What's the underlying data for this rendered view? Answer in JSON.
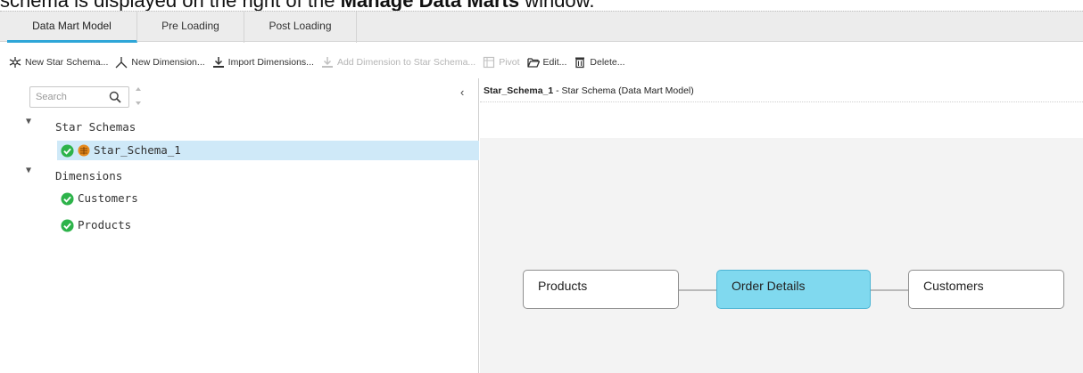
{
  "caption": {
    "prefix": "schema is displayed on the right of the ",
    "bold": "Manage Data Marts",
    "suffix": " window."
  },
  "tabs": [
    {
      "label": "Data Mart Model",
      "active": true
    },
    {
      "label": "Pre Loading",
      "active": false
    },
    {
      "label": "Post Loading",
      "active": false
    }
  ],
  "toolbar": {
    "new_star_schema": "New Star Schema...",
    "new_dimension": "New Dimension...",
    "import_dimensions": "Import Dimensions...",
    "add_dimension": "Add Dimension to Star Schema...",
    "pivot": "Pivot",
    "edit": "Edit...",
    "delete": "Delete..."
  },
  "search": {
    "placeholder": "Search"
  },
  "tree": {
    "star_schemas_label": "Star Schemas",
    "star_schema_item": "Star_Schema_1",
    "dimensions_label": "Dimensions",
    "dimension_items": [
      "Customers",
      "Products"
    ]
  },
  "right": {
    "title_bold": "Star_Schema_1",
    "title_rest": " - Star Schema (Data Mart Model)"
  },
  "diagram": {
    "left_node": "Products",
    "fact_node": "Order Details",
    "right_node": "Customers"
  },
  "colors": {
    "accent": "#2ea6d8",
    "fact_fill": "#80d9ef",
    "selected_row": "#cfe9f8",
    "ok_green": "#2db34a",
    "schema_orange": "#e58a1e"
  }
}
